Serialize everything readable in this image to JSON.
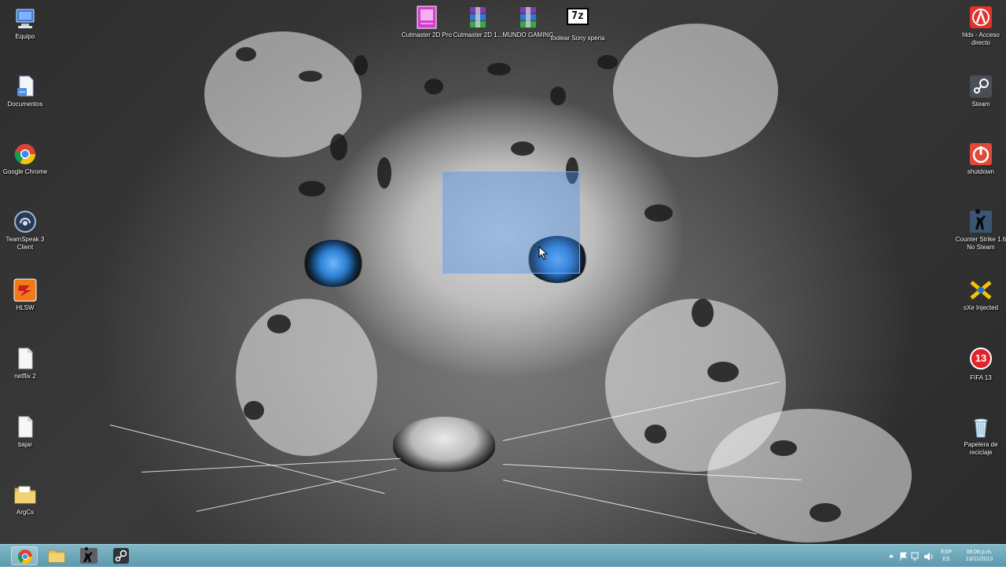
{
  "desktop": {
    "left_icons": [
      {
        "label": "Equipo",
        "icon": "computer-icon"
      },
      {
        "label": "Documentos",
        "icon": "documents-icon"
      },
      {
        "label": "Google Chrome",
        "icon": "chrome-icon"
      },
      {
        "label": "TeamSpeak 3 Client",
        "icon": "teamspeak-icon"
      },
      {
        "label": "HLSW",
        "icon": "hlsw-icon"
      },
      {
        "label": "netflix 2",
        "icon": "document-icon"
      },
      {
        "label": "bajar",
        "icon": "document-icon"
      },
      {
        "label": "ArgCs",
        "icon": "folder-icon"
      }
    ],
    "top_icons": [
      {
        "label": "Cutmaster 2D Pro",
        "icon": "cutmaster-icon"
      },
      {
        "label": "Cutmaster 2D 1...",
        "icon": "winrar-icon"
      },
      {
        "label": "MUNDO GAMING",
        "icon": "winrar-icon"
      },
      {
        "label": "toolear Sony xperia",
        "icon": "7zip-icon"
      }
    ],
    "right_icons": [
      {
        "label": "hlds - Acceso directo",
        "icon": "half-life-icon"
      },
      {
        "label": "Steam",
        "icon": "steam-icon"
      },
      {
        "label": "shutdown",
        "icon": "shutdown-icon"
      },
      {
        "label": "Counter Strike 1.6 No Steam",
        "icon": "counter-strike-icon"
      },
      {
        "label": "sXe Injected",
        "icon": "sxe-icon"
      },
      {
        "label": "FIFA 13",
        "icon": "fifa-icon"
      },
      {
        "label": "Papelera de reciclaje",
        "icon": "recycle-bin-icon"
      }
    ],
    "seven_zip_glyph": "7z",
    "fifa_glyph": "13"
  },
  "taskbar": {
    "pinned": [
      {
        "name": "Google Chrome",
        "icon": "chrome-icon",
        "active": true
      },
      {
        "name": "Explorador",
        "icon": "folder-icon",
        "active": false
      },
      {
        "name": "Counter Strike",
        "icon": "counter-strike-icon",
        "active": false
      },
      {
        "name": "Steam",
        "icon": "steam-icon",
        "active": false
      }
    ],
    "language": {
      "top": "ESP",
      "bottom": "ES"
    },
    "clock": {
      "time": "08:06 p.m.",
      "date": "13/11/2013"
    }
  },
  "colors": {
    "taskbar": "#6aa6ba",
    "selection": "#4a8ce6"
  }
}
